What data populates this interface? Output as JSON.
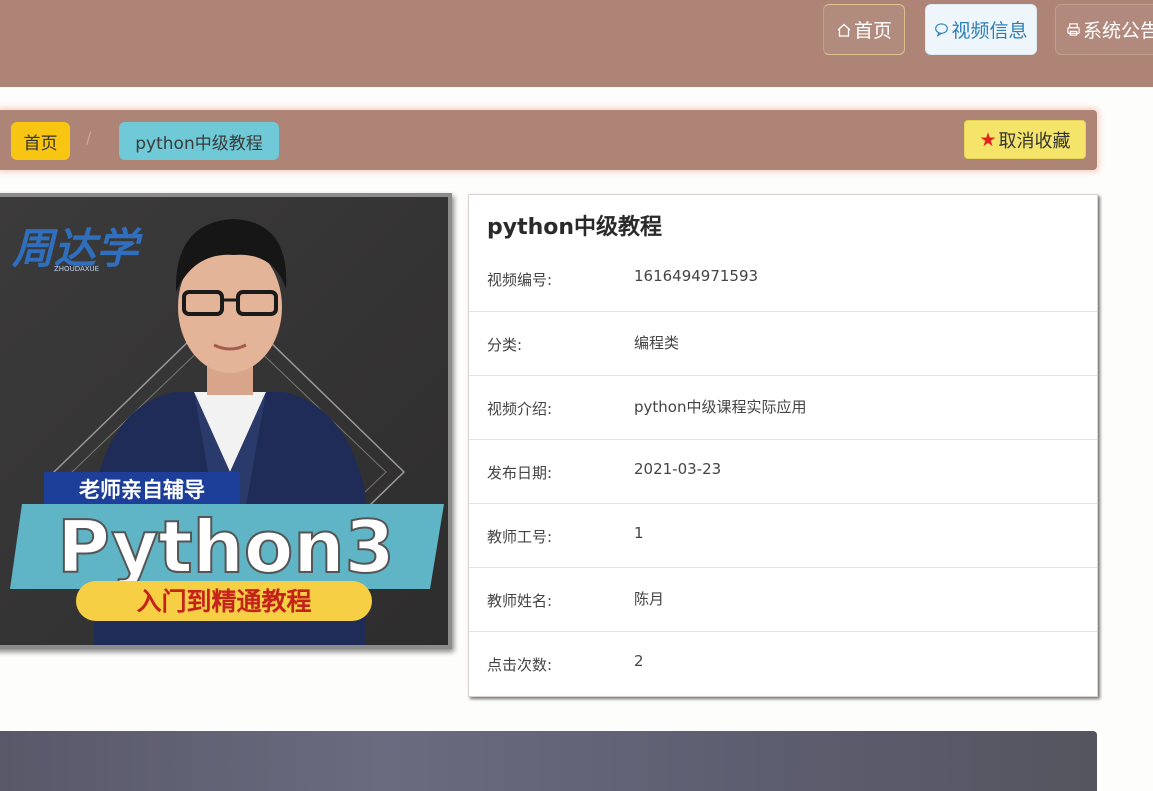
{
  "nav": {
    "home_label": "首页",
    "video_label": "视频信息",
    "notice_label": "系统公告"
  },
  "breadcrumb": {
    "home": "首页",
    "separator": "/",
    "current": "python中级教程"
  },
  "favorite": {
    "label": "取消收藏",
    "star_color": "#e3211c"
  },
  "cover": {
    "logo_text": "周达学",
    "logo_subtext": "ZHOUDAXUE",
    "banner_top": "老师亲自辅导",
    "big_title": "Python3",
    "banner_bottom": "入门到精通教程"
  },
  "detail": {
    "title": "python中级教程",
    "rows": [
      {
        "label": "视频编号:",
        "value": "1616494971593"
      },
      {
        "label": "分类:",
        "value": "编程类"
      },
      {
        "label": "视频介绍:",
        "value": "python中级课程实际应用"
      },
      {
        "label": "发布日期:",
        "value": "2021-03-23"
      },
      {
        "label": "教师工号:",
        "value": "1"
      },
      {
        "label": "教师姓名:",
        "value": "陈月"
      },
      {
        "label": "点击次数:",
        "value": "2"
      }
    ]
  },
  "colors": {
    "topbar": "#ad8476",
    "crumb_home": "#f8c513",
    "crumb_current": "#6fc9d7",
    "favorite_button": "#f4e46a"
  }
}
